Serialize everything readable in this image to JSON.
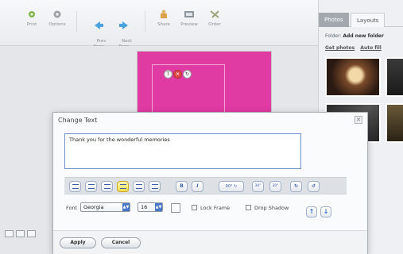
{
  "toolbar": {
    "items": [
      {
        "label": "Print"
      },
      {
        "label": "Options"
      },
      {
        "label": "Prev\nPage"
      },
      {
        "label": "Next\nPage"
      },
      {
        "label": "Share"
      },
      {
        "label": "Preview"
      },
      {
        "label": "Order"
      }
    ]
  },
  "canvas": {
    "frame_tools": [
      "T",
      "✕",
      "↻"
    ],
    "page_color": "#e03aa3"
  },
  "right_panel": {
    "tabs": [
      "Photos",
      "Layouts"
    ],
    "folder_label": "Folder:",
    "folder_value": "Add new folder",
    "links": [
      "Get photos",
      "Auto fill"
    ]
  },
  "dialog": {
    "title": "Change Text",
    "text_value": "Thank you for the wonderful memories",
    "format_buttons": [
      {
        "icon": "align-left-icon"
      },
      {
        "icon": "align-center-icon"
      },
      {
        "icon": "align-right-icon"
      },
      {
        "icon": "valign-top-icon"
      },
      {
        "icon": "valign-middle-icon"
      },
      {
        "icon": "valign-bottom-icon"
      },
      {
        "icon": "bold-icon",
        "label": "B"
      },
      {
        "icon": "italic-icon",
        "label": "I"
      },
      {
        "icon": "rotate-90-icon",
        "label": "90°"
      },
      {
        "icon": "rotate-30-icon",
        "label": "30°"
      },
      {
        "icon": "rotate-30-ccw-icon",
        "label": "30°"
      },
      {
        "icon": "rotate-right-icon"
      },
      {
        "icon": "rotate-left-icon"
      }
    ],
    "font_label": "Font",
    "font_value": "Georgia",
    "size_value": "16",
    "lock_frame_label": "Lock Frame",
    "drop_shadow_label": "Drop Shadow",
    "apply_label": "Apply",
    "cancel_label": "Cancel",
    "accent": "#4a78c8"
  }
}
